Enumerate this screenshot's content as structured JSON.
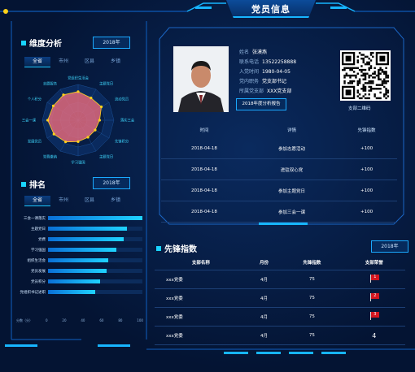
{
  "header": {
    "title": "党员信息"
  },
  "dimension": {
    "title": "维度分析",
    "year": "2018年",
    "tabs": [
      "全省",
      "市州",
      "区县",
      "乡镇"
    ],
    "radar_labels": [
      "党组织生活会",
      "主题党日",
      "流动党员",
      "落实三会",
      "先锋积分",
      "主题党日",
      "学习强国",
      "党费缴纳",
      "发展党员",
      "三会一课",
      "个人积分",
      "志愿服务"
    ]
  },
  "ranking": {
    "title": "排名",
    "year": "2018年",
    "tabs": [
      "全省",
      "市州",
      "区县",
      "乡镇"
    ],
    "items": [
      {
        "label": "三会一课落实",
        "value": 100
      },
      {
        "label": "主题党日",
        "value": 84
      },
      {
        "label": "党费",
        "value": 80
      },
      {
        "label": "学习强国",
        "value": 72
      },
      {
        "label": "组织生活会",
        "value": 64
      },
      {
        "label": "党员发展",
        "value": 62
      },
      {
        "label": "党员积分",
        "value": 55
      },
      {
        "label": "党组织书记述职",
        "value": 50
      }
    ],
    "axis_label": "分数（分）",
    "axis_ticks": [
      "0",
      "20",
      "40",
      "60",
      "80",
      "100"
    ]
  },
  "profile": {
    "name_label": "姓名",
    "name": "张漠燕",
    "phone_label": "联系电话",
    "phone": "13522258888",
    "join_label": "入党时间",
    "join": "1980-04-05",
    "position_label": "党内职务",
    "position": "党支部书记",
    "branch_label": "所属党支部",
    "branch": "XXX党支部",
    "report_button": "2018年度分析报告",
    "qr_label": "支部二维码"
  },
  "activity_table": {
    "headers": [
      "时间",
      "详情",
      "先锋指数"
    ],
    "rows": [
      [
        "2018-04-18",
        "参加志愿活动",
        "+100"
      ],
      [
        "2018-04-18",
        "进驻双心党",
        "+100"
      ],
      [
        "2018-04-18",
        "参加主题党日",
        "+100"
      ],
      [
        "2018-04-18",
        "参加三会一课",
        "+100"
      ]
    ]
  },
  "pioneer": {
    "title": "先锋指数",
    "year": "2018年",
    "headers": [
      "支部名称",
      "月份",
      "先锋指数",
      "支部荣誉"
    ],
    "rows": [
      {
        "name": "xxx党委",
        "month": "4月",
        "score": "75",
        "rank": "1"
      },
      {
        "name": "xxx党委",
        "month": "4月",
        "score": "75",
        "rank": "2"
      },
      {
        "name": "xxx党委",
        "month": "4月",
        "score": "75",
        "rank": "3"
      },
      {
        "name": "xxx党委",
        "month": "4月",
        "score": "75",
        "rank": "4"
      }
    ]
  }
}
